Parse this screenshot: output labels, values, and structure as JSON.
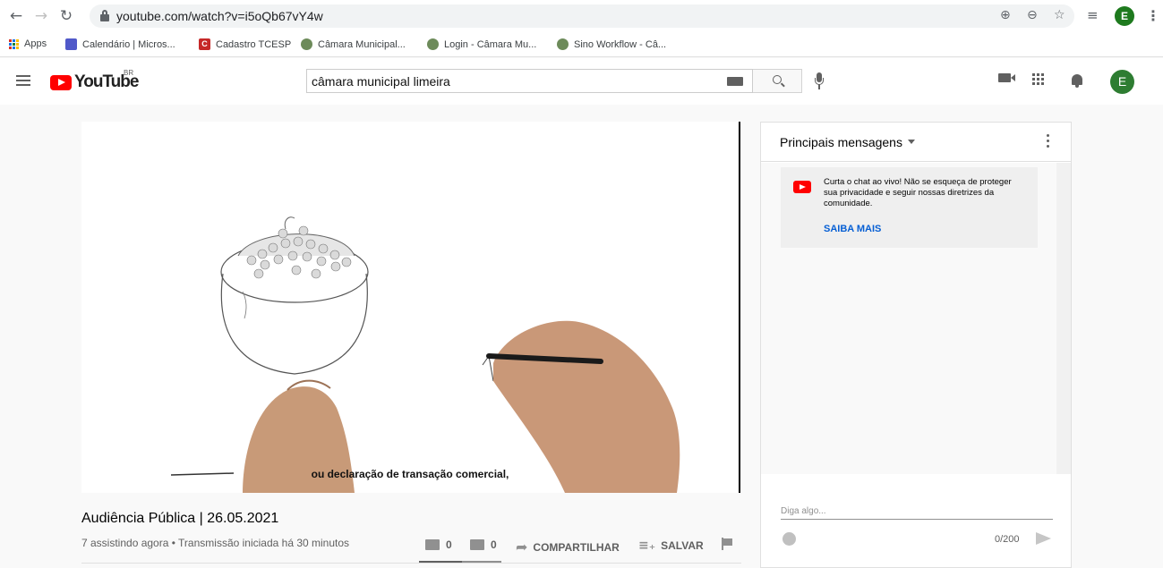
{
  "browser": {
    "url": "youtube.com/watch?v=i5oQb67vY4w",
    "profile_initial": "E",
    "bookmarks": [
      {
        "label": "Apps"
      },
      {
        "label": "Calendário | Micros..."
      },
      {
        "label": "Cadastro TCESP",
        "icon_letter": "C"
      },
      {
        "label": "Câmara Municipal..."
      },
      {
        "label": "Login - Câmara Mu..."
      },
      {
        "label": "Sino Workflow - Câ..."
      }
    ]
  },
  "youtube": {
    "logo_text": "YouTube",
    "country_code": "BR",
    "search_value": "câmara municipal limeira",
    "avatar_initial": "E"
  },
  "video": {
    "caption": "ou declaração de transação comercial,",
    "title": "Audiência Pública | 26.05.2021",
    "meta": "7 assistindo agora • Transmissão iniciada há 30 minutos",
    "likes": "0",
    "dislikes": "0",
    "share_label": "COMPARTILHAR",
    "save_label": "SALVAR"
  },
  "chat": {
    "title": "Principais mensagens",
    "notice_text": "Curta o chat ao vivo! Não se esqueça de proteger sua privacidade e seguir nossas diretrizes da comunidade.",
    "notice_link": "SAIBA MAIS",
    "input_placeholder": "Diga algo...",
    "counter": "0/200"
  },
  "colors": {
    "brand_red": "#ff0000",
    "link_blue": "#065fd4",
    "profile_green": "#2e7d32"
  }
}
